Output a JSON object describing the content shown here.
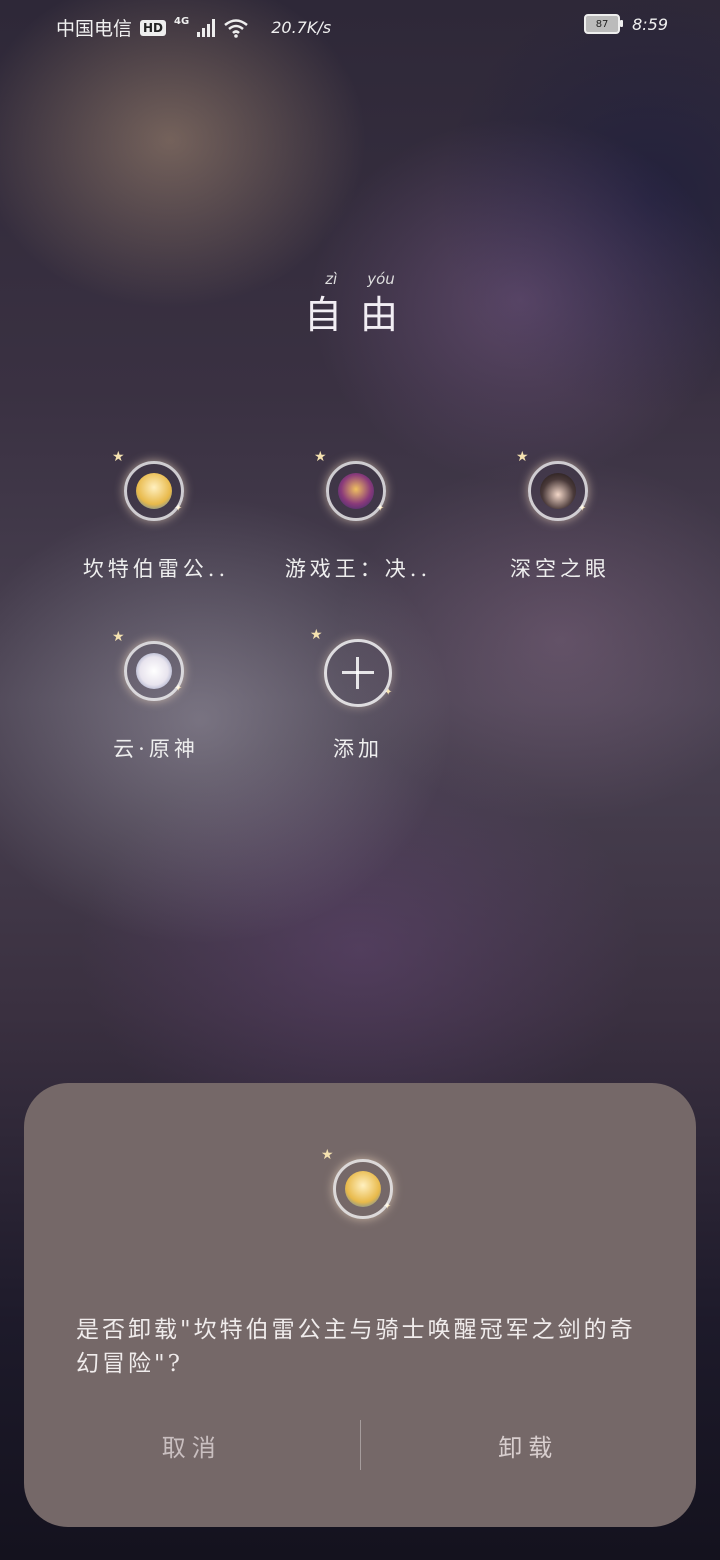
{
  "status": {
    "carrier": "中国电信",
    "hd": "HD",
    "net": "4G",
    "speed": "20.7K/s",
    "battery": "87",
    "time": "8:59"
  },
  "folder": {
    "title": "自由",
    "title_pinyin": [
      "zì",
      "yóu"
    ]
  },
  "apps": [
    {
      "label": "坎特伯雷公..",
      "icon": "blonde-hero-icon",
      "color": "#e8b94a"
    },
    {
      "label": "游戏王：决..",
      "icon": "duelist-icon",
      "color": "#8a3a7a"
    },
    {
      "label": "深空之眼",
      "icon": "dark-hair-girl-icon",
      "color": "#4a3a3a"
    },
    {
      "label": "云·原神",
      "icon": "paimon-icon",
      "color": "#e8e4ee"
    },
    {
      "label": "添加",
      "icon": "add-icon"
    }
  ],
  "dialog": {
    "message": "是否卸载\"坎特伯雷公主与骑士唤醒冠军之剑的奇幻冒险\"?",
    "cancel_label": "取消",
    "uninstall_label": "卸载"
  }
}
